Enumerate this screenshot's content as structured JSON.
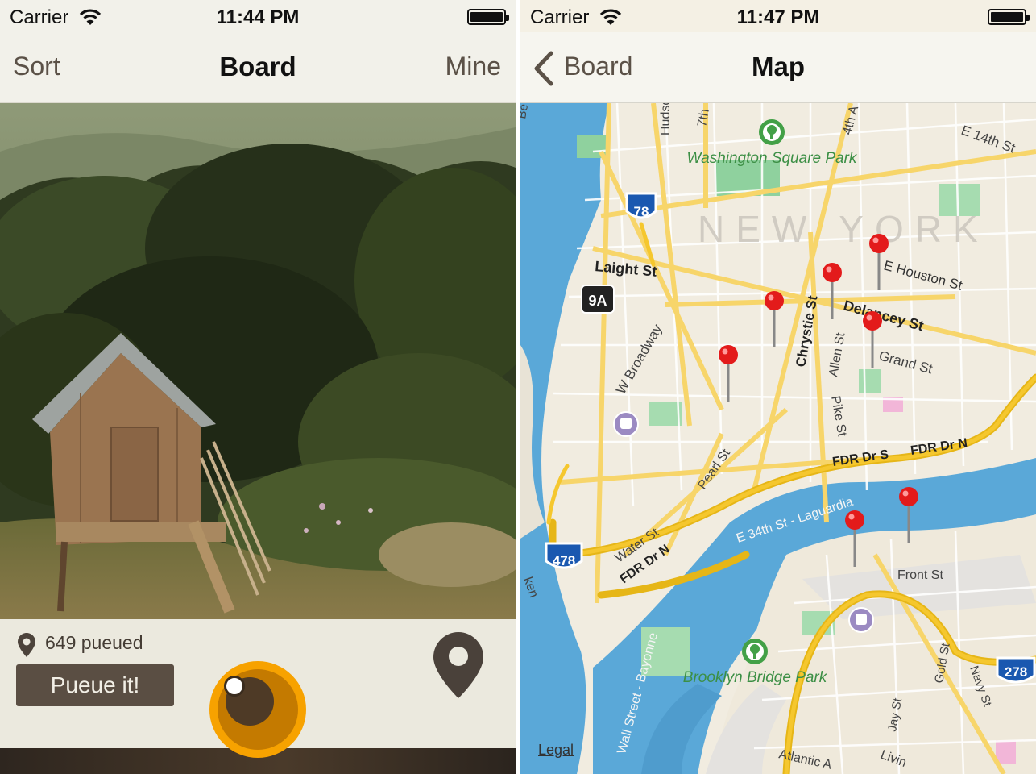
{
  "left_screen": {
    "status_bar": {
      "carrier": "Carrier",
      "time": "11:44 PM"
    },
    "nav": {
      "left_button": "Sort",
      "title": "Board",
      "right_button": "Mine"
    },
    "card": {
      "pueue_count": "649 pueued",
      "action_button": "Pueue it!"
    },
    "icons": {
      "location": "map-pin-icon",
      "camera": "camera-lens-icon"
    },
    "colors": {
      "accent_orange": "#f7a200",
      "button_brown": "#5a4e43",
      "footer_bg": "#ebe9de"
    }
  },
  "right_screen": {
    "status_bar": {
      "carrier": "Carrier",
      "time": "11:47 PM"
    },
    "nav": {
      "back_label": "Board",
      "title": "Map"
    },
    "map": {
      "city_label": "NEW YORK",
      "parks": [
        "Washington Square Park",
        "Brooklyn Bridge Park"
      ],
      "streets": [
        "Hudson",
        "7th",
        "4th A",
        "E 14th St",
        "Laight St",
        "W Broadway",
        "E Houston St",
        "Chrystie St",
        "Delancey St",
        "Allen St",
        "Grand St",
        "Pike St",
        "Pearl St",
        "FDR Dr S",
        "FDR Dr N",
        "E 34th St - Laguardia",
        "Water St",
        "FDR Dr N",
        "Front St",
        "Gold St",
        "Navy St",
        "Jay St",
        "Wall Street - Bayonne",
        "Atlantic A",
        "Livin"
      ],
      "edge_labels": [
        "Be",
        "ken"
      ],
      "route_shields": [
        "78",
        "9A",
        "478",
        "278"
      ],
      "legal": "Legal"
    },
    "colors": {
      "pin_red": "#e31b1b",
      "highway_yellow": "#f5c72e",
      "water_blue": "#5aa8d8"
    }
  }
}
